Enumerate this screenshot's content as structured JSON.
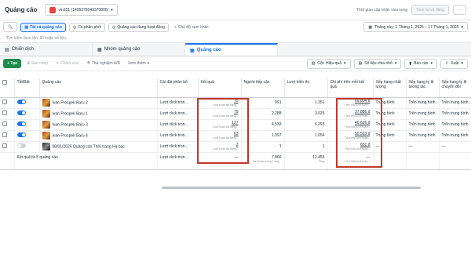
{
  "header": {
    "title": "Quảng cáo",
    "account_label": "vin151 (1405378243370806)",
    "last_update": "Thời gian cập nhật: vừa xong",
    "view_setup": "Xem lại và đăng"
  },
  "filters": {
    "chips": [
      "Tất cả quảng cáo",
      "Có phân phối",
      "Quảng cáo đang hoạt động",
      "Chế độ xem khác"
    ],
    "date_range": "Tháng này: 1 Tháng 1, 2025 – 17 Tháng 1, 2025",
    "search_placeholder": "Tìm kiếm theo tên, ID hoặc số liệu"
  },
  "tabs": [
    "Chiến dịch",
    "Nhóm quảng cáo",
    "Quảng cáo"
  ],
  "toolbar": {
    "create": "+ Tạo",
    "copy": "Sao chép",
    "edit": "Chỉnh sửa",
    "ab_test": "Thử nghiệm A/B",
    "more": "Xem thêm",
    "columns": "Cột: Hiệu quả",
    "breakdown": "Số liệu chia nhỏ",
    "reports": "Báo cáo",
    "export": "Xuất"
  },
  "table": {
    "headers": {
      "toggle": "Tắt/Bật",
      "ad": "Quảng cáo",
      "attribution": "Cài đặt phân bổ",
      "results": "Kết quả",
      "reach": "Người tiếp cận",
      "impressions": "Lượt hiển thị",
      "cost_per_result": "Chi phí trên mỗi kết quả",
      "quality": "Xếp hạng chất lượng",
      "engagement": "Xếp hạng tỷ lệ tương tác",
      "conversion": "Xếp hạng tỷ lệ chuyển đổi"
    },
    "rows": [
      {
        "name": "Ivan Prospek Baru 2",
        "attr": "Lượt click tron...",
        "result": "75",
        "result_sub": "Lượt hoàn tất đăng...",
        "reach": "991",
        "impr": "1.351",
        "cost": "69.004 đ",
        "cost_sub": "Trên mỗi lượt hoàn...",
        "q": "Trung bình",
        "e": "Trên trung bình",
        "c": "Trên trung bình",
        "on": true
      },
      {
        "name": "Ivan Prospek Baru 1",
        "attr": "Lượt click tron...",
        "result": "79",
        "result_sub": "Lượt hoàn tất đăng...",
        "reach": "2.288",
        "impr": "3.026",
        "cost": "37.886 đ",
        "cost_sub": "Trên mỗi lượt hoàn...",
        "q": "Trung bình",
        "e": "Trên trung bình",
        "c": "Trên trung bình",
        "on": true
      },
      {
        "name": "Ivan Prospek Baru 3",
        "attr": "Lượt click tron...",
        "result": "127",
        "result_sub": "Lượt hoàn tất đăng...",
        "reach": "4.533",
        "impr": "6.293",
        "cost": "40.626 đ",
        "cost_sub": "Trên mỗi lượt hoàn...",
        "q": "Trung bình",
        "e": "Trên trung bình",
        "c": "Trên trung bình",
        "on": true
      },
      {
        "name": "Ivan Prospek Baru 4",
        "attr": "Lượt click tron...",
        "result": "63",
        "result_sub": "Lượt hoàn tất đăng...",
        "reach": "1.397",
        "impr": "1.654",
        "cost": "50.503 đ",
        "cost_sub": "Trên mỗi lượt hoàn...",
        "q": "Trung bình",
        "e": "Trên trung bình",
        "c": "Trên trung bình",
        "on": true
      },
      {
        "name": "08/01/2025 Quảng cáo Thời trang Hạ bạc",
        "attr": "Lượt click tron...",
        "result": "2",
        "result_sub": "Lượt hoàn tất đăng...",
        "reach": "1",
        "impr": "1",
        "cost": "651 đ",
        "cost_sub": "Trên mỗi lượt hoàn...",
        "q": "—",
        "e": "—",
        "c": "—",
        "on": false
      }
    ],
    "summary": {
      "label": "Kết quả từ 5 quảng cáo",
      "attr": "Lượt click tron...",
      "result": "—",
      "reach": "7.866",
      "reach_sub": "Tài khoản trung Trung...",
      "impr": "12.455",
      "impr_sub": "Tổng",
      "cost": "—",
      "cost_sub": "Trên mỗi lượt hoàn..."
    }
  }
}
